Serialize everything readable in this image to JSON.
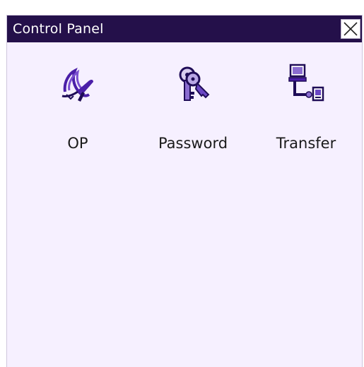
{
  "window": {
    "title": "Control Panel",
    "close_symbol": "×"
  },
  "applets": [
    {
      "label": "OP",
      "icon": "op-icon"
    },
    {
      "label": "Password",
      "icon": "key-icon"
    },
    {
      "label": "Transfer",
      "icon": "transfer-icon"
    }
  ],
  "colors": {
    "titlebar": "#24104a",
    "window_background": "#f6f0ff",
    "icon_primary": "#4b1fa8",
    "icon_dark": "#1f0c57"
  }
}
